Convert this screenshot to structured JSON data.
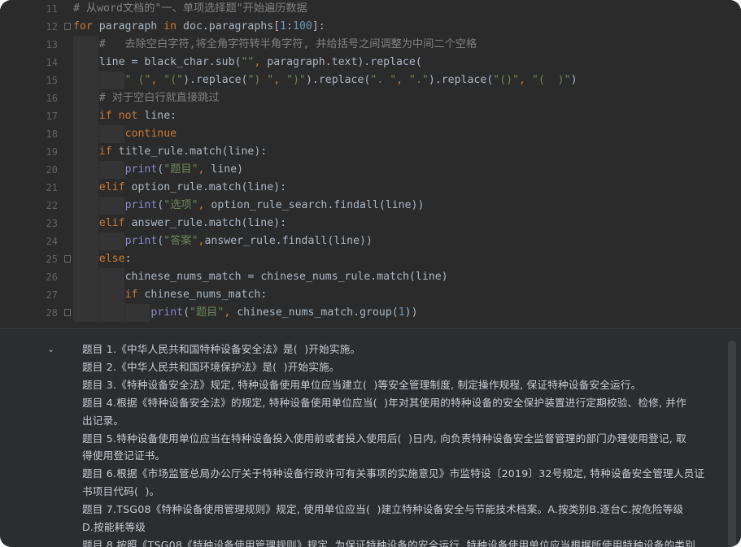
{
  "editor": {
    "lines": [
      {
        "num": "11",
        "indent": 0,
        "fold": false,
        "tokens": [
          {
            "c": "cm",
            "t": "# 从word文档的\"一、单项选择题\"开始遍历数据"
          }
        ]
      },
      {
        "num": "12",
        "indent": 0,
        "fold": true,
        "tokens": [
          {
            "c": "kw",
            "t": "for "
          },
          {
            "c": "tx",
            "t": "paragraph "
          },
          {
            "c": "kw",
            "t": "in "
          },
          {
            "c": "tx",
            "t": "doc.paragraphs["
          },
          {
            "c": "nm",
            "t": "1"
          },
          {
            "c": "tx",
            "t": ":"
          },
          {
            "c": "nm",
            "t": "100"
          },
          {
            "c": "tx",
            "t": "]:"
          }
        ]
      },
      {
        "num": "13",
        "indent": 1,
        "fold": false,
        "tokens": [
          {
            "c": "cm",
            "t": "#   去除空白字符,将全角字符转半角字符, 并给括号之间调整为中间二个空格"
          }
        ]
      },
      {
        "num": "14",
        "indent": 1,
        "fold": false,
        "tokens": [
          {
            "c": "tx",
            "t": "line = black_char.sub("
          },
          {
            "c": "st",
            "t": "\"\""
          },
          {
            "c": "kw",
            "t": ", "
          },
          {
            "c": "tx",
            "t": "paragraph.text).replace("
          }
        ]
      },
      {
        "num": "15",
        "indent": 2,
        "fold": false,
        "tokens": [
          {
            "c": "st",
            "t": "\" (\""
          },
          {
            "c": "kw",
            "t": ", "
          },
          {
            "c": "st",
            "t": "\"(\""
          },
          {
            "c": "tx",
            "t": ").replace("
          },
          {
            "c": "st",
            "t": "\") \""
          },
          {
            "c": "kw",
            "t": ", "
          },
          {
            "c": "st",
            "t": "\")\""
          },
          {
            "c": "tx",
            "t": ").replace("
          },
          {
            "c": "st",
            "t": "\". \""
          },
          {
            "c": "kw",
            "t": ", "
          },
          {
            "c": "st",
            "t": "\".\""
          },
          {
            "c": "tx",
            "t": ").replace("
          },
          {
            "c": "st",
            "t": "\"()\""
          },
          {
            "c": "kw",
            "t": ", "
          },
          {
            "c": "st",
            "t": "\"(  )\""
          },
          {
            "c": "tx",
            "t": ")"
          }
        ]
      },
      {
        "num": "16",
        "indent": 1,
        "fold": false,
        "tokens": [
          {
            "c": "cm",
            "t": "# 对于空白行就直接跳过"
          }
        ]
      },
      {
        "num": "17",
        "indent": 1,
        "fold": false,
        "tokens": [
          {
            "c": "kw",
            "t": "if not "
          },
          {
            "c": "tx",
            "t": "line:"
          }
        ]
      },
      {
        "num": "18",
        "indent": 2,
        "fold": false,
        "tokens": [
          {
            "c": "kw",
            "t": "continue"
          }
        ]
      },
      {
        "num": "19",
        "indent": 1,
        "fold": false,
        "tokens": [
          {
            "c": "kw",
            "t": "if "
          },
          {
            "c": "tx",
            "t": "title_rule.match(line):"
          }
        ]
      },
      {
        "num": "20",
        "indent": 2,
        "fold": false,
        "tokens": [
          {
            "c": "fn",
            "t": "print"
          },
          {
            "c": "tx",
            "t": "("
          },
          {
            "c": "st",
            "t": "\"题目\""
          },
          {
            "c": "kw",
            "t": ", "
          },
          {
            "c": "tx",
            "t": "line)"
          }
        ]
      },
      {
        "num": "21",
        "indent": 1,
        "fold": false,
        "tokens": [
          {
            "c": "kw",
            "t": "elif "
          },
          {
            "c": "tx",
            "t": "option_rule.match(line):"
          }
        ]
      },
      {
        "num": "22",
        "indent": 2,
        "fold": false,
        "tokens": [
          {
            "c": "fn",
            "t": "print"
          },
          {
            "c": "tx",
            "t": "("
          },
          {
            "c": "st",
            "t": "\"选项\""
          },
          {
            "c": "kw",
            "t": ", "
          },
          {
            "c": "tx",
            "t": "option_rule_search.findall(line))"
          }
        ]
      },
      {
        "num": "23",
        "indent": 1,
        "fold": false,
        "tokens": [
          {
            "c": "kw",
            "t": "elif "
          },
          {
            "c": "tx",
            "t": "answer_rule.match(line):"
          }
        ]
      },
      {
        "num": "24",
        "indent": 2,
        "fold": false,
        "tokens": [
          {
            "c": "fn",
            "t": "print"
          },
          {
            "c": "tx",
            "t": "("
          },
          {
            "c": "st",
            "t": "\"答案\""
          },
          {
            "c": "kw",
            "t": ","
          },
          {
            "c": "tx",
            "t": "answer_rule.findall(line))"
          }
        ]
      },
      {
        "num": "25",
        "indent": 1,
        "fold": true,
        "tokens": [
          {
            "c": "kw",
            "t": "else"
          },
          {
            "c": "tx",
            "t": ":"
          }
        ]
      },
      {
        "num": "26",
        "indent": 2,
        "fold": false,
        "tokens": [
          {
            "c": "tx",
            "t": "chinese_nums_match = chinese_nums_rule.match(line)"
          }
        ]
      },
      {
        "num": "27",
        "indent": 2,
        "fold": false,
        "tokens": [
          {
            "c": "kw",
            "t": "if "
          },
          {
            "c": "tx",
            "t": "chinese_nums_match:"
          }
        ]
      },
      {
        "num": "28",
        "indent": 3,
        "fold": true,
        "tokens": [
          {
            "c": "fn",
            "t": "print"
          },
          {
            "c": "tx",
            "t": "("
          },
          {
            "c": "st",
            "t": "\"题目\""
          },
          {
            "c": "kw",
            "t": ", "
          },
          {
            "c": "tx",
            "t": "chinese_nums_match.group("
          },
          {
            "c": "nm",
            "t": "1"
          },
          {
            "c": "tx",
            "t": "))"
          }
        ]
      }
    ]
  },
  "console": {
    "toggle_icon": "chevron-down-icon",
    "lines": [
      "题目 1.《中华人民共和国特种设备安全法》是(  )开始实施。",
      "题目 2.《中华人民共和国环境保护法》是(  )开始实施。",
      "题目 3.《特种设备安全法》规定, 特种设备使用单位应当建立(  )等安全管理制度, 制定操作规程, 保证特种设备安全运行。",
      "题目 4.根据《特种设备安全法》的规定, 特种设备使用单位应当(  )年对其使用的特种设备的安全保护装置进行定期校验、检修, 并作",
      "出记录。",
      "题目 5.特种设备使用单位应当在特种设备投入使用前或者投入使用后(  )日内, 向负责特种设备安全监督管理的部门办理使用登记, 取",
      "得使用登记证书。",
      "题目 6.根据《市场监管总局办公厅关于特种设备行政许可有关事项的实施意见》市监特设〔2019〕32号规定, 特种设备安全管理人员证",
      "书项目代码(  )。",
      "题目 7.TSG08《特种设备使用管理规则》规定, 使用单位应当(  )建立特种设备安全与节能技术档案。A.按类别B.逐台C.按危险等级",
      "D.按能耗等级",
      "题目 8.按照《TSG08《特种设备使用管理规则》规定, 为保证特种设备的安全运行, 特种设备使用单位应当根据所使用特种设备的类别"
    ]
  }
}
